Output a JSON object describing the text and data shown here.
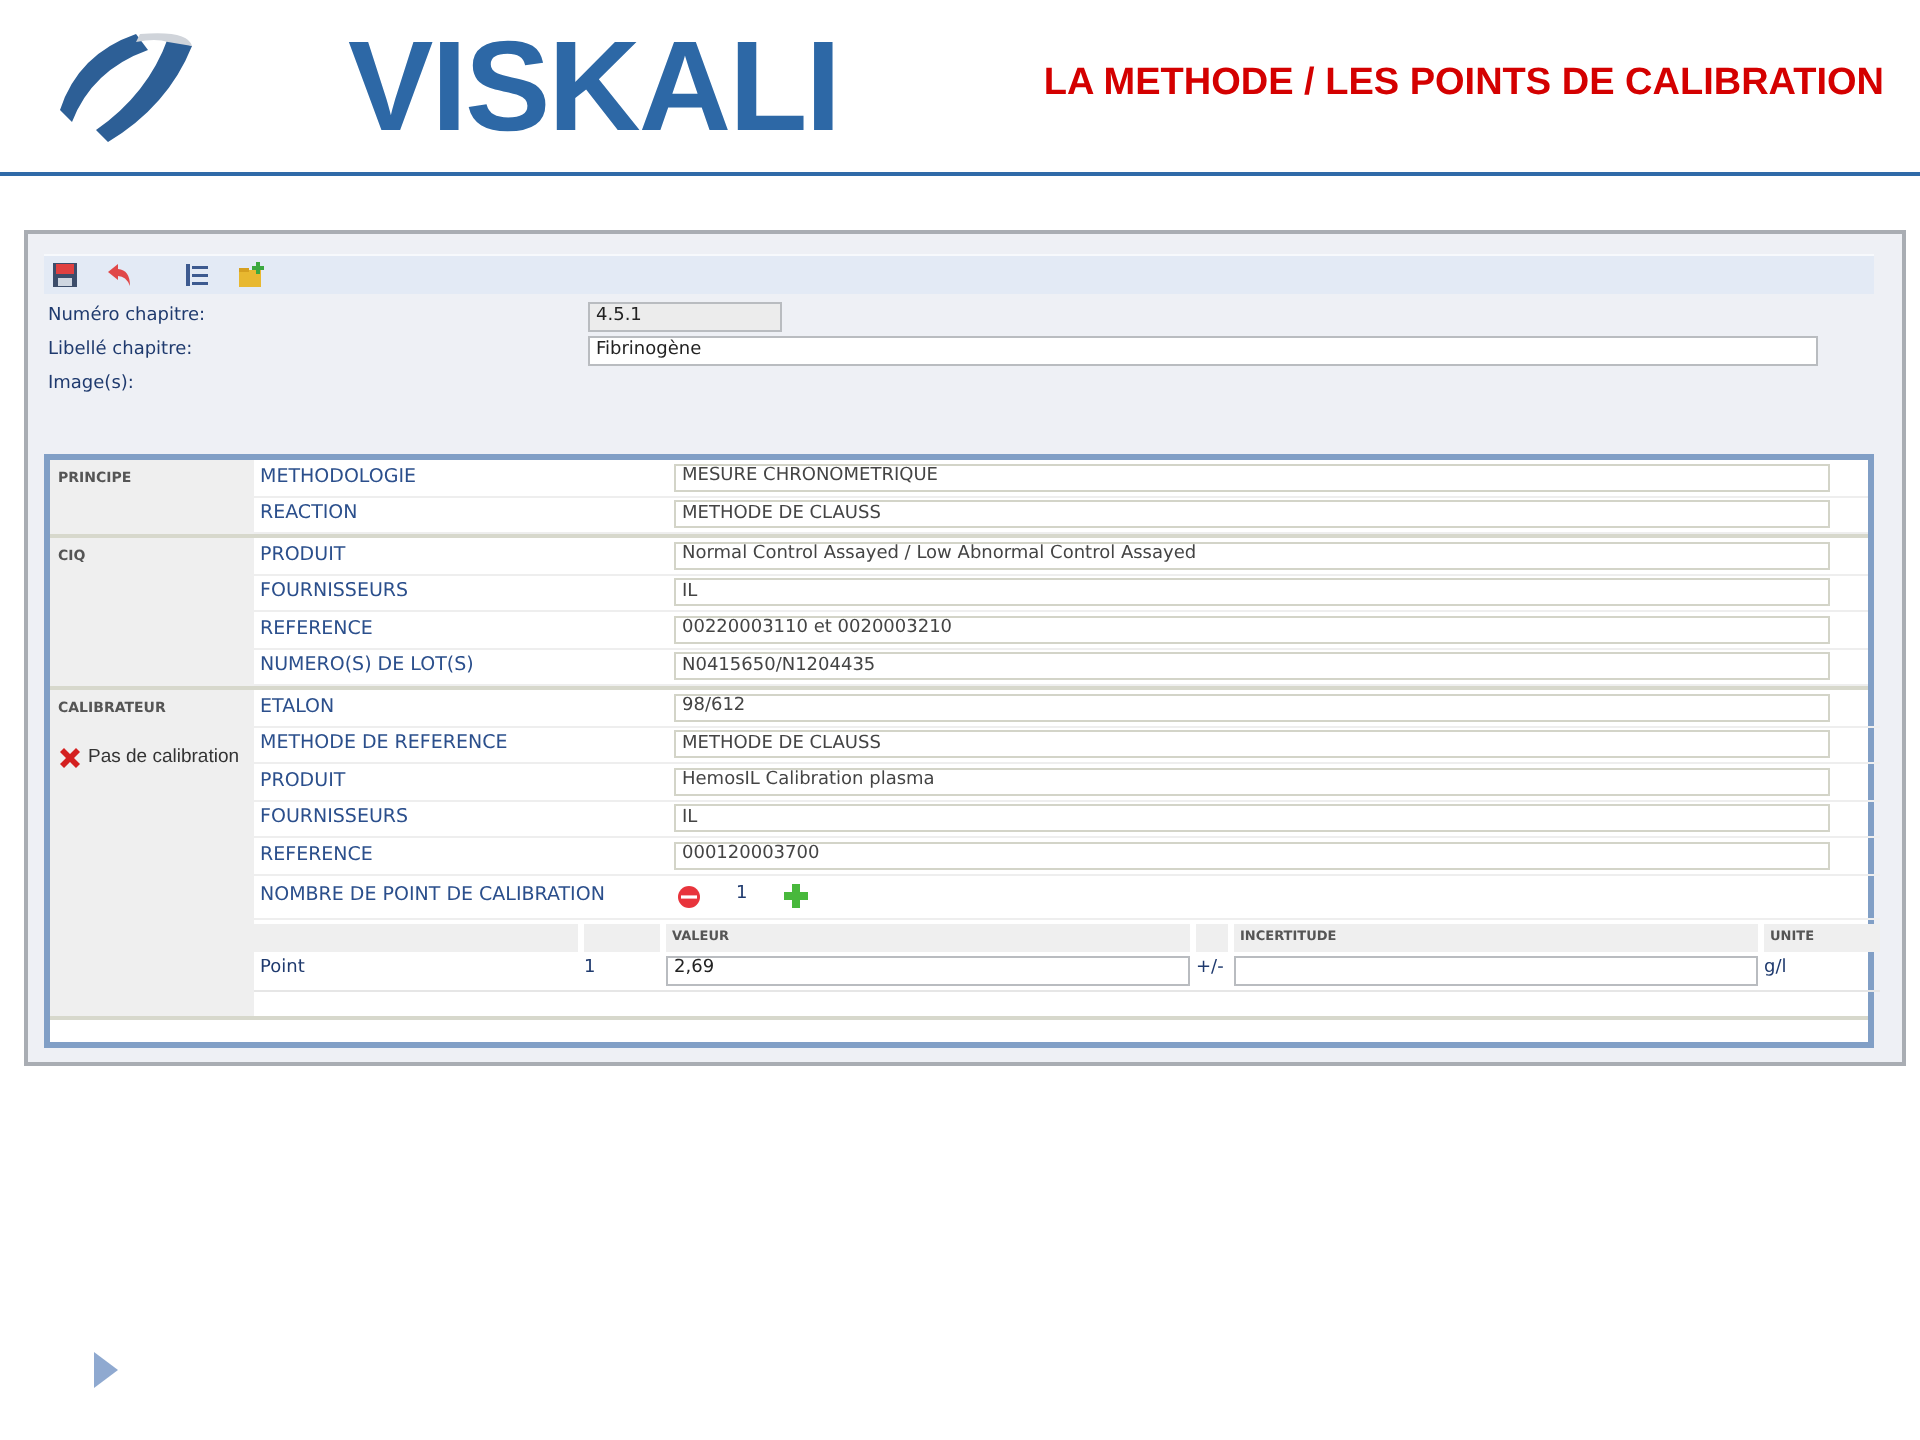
{
  "header": {
    "logo_text": "VISKALI",
    "title": "LA METHODE / LES POINTS DE CALIBRATION"
  },
  "chapter_fields": [
    {
      "label": "Numéro chapitre:",
      "value": "4.5.1",
      "disabled": true,
      "wide": false
    },
    {
      "label": "Libellé chapitre:",
      "value": "Fibrinogène",
      "disabled": false,
      "wide": true
    },
    {
      "label": "Image(s):"
    }
  ],
  "sections": [
    {
      "title": "PRINCIPE",
      "rows": [
        {
          "label": "METHODOLOGIE",
          "value": "MESURE CHRONOMETRIQUE"
        },
        {
          "label": "REACTION",
          "value": "METHODE DE CLAUSS"
        }
      ]
    },
    {
      "title": "CIQ",
      "rows": [
        {
          "label": "PRODUIT",
          "value": "Normal Control Assayed / Low Abnormal Control Assayed"
        },
        {
          "label": "FOURNISSEURS",
          "value": "IL"
        },
        {
          "label": "REFERENCE",
          "value": "00220003110 et 0020003210"
        },
        {
          "label": "NUMERO(S) DE LOT(S)",
          "value": "N0415650/N1204435"
        }
      ]
    },
    {
      "title": "CALIBRATEUR",
      "status": "Pas de calibration",
      "rows": [
        {
          "label": "ETALON",
          "value": "98/612"
        },
        {
          "label": "METHODE DE REFERENCE",
          "value": "METHODE DE CLAUSS"
        },
        {
          "label": "PRODUIT",
          "value": "HemosIL Calibration plasma"
        },
        {
          "label": "FOURNISSEURS",
          "value": "IL"
        },
        {
          "label": "REFERENCE",
          "value": "000120003700"
        }
      ],
      "count": {
        "label": "NOMBRE DE POINT DE CALIBRATION",
        "value": "1"
      },
      "points_table": {
        "columns": [
          "VALEUR",
          "INCERTITUDE",
          "UNITE"
        ],
        "rows": [
          {
            "label": "Point",
            "number": "1",
            "value": "2,69",
            "plusminus": "+/-",
            "unit": "g/l"
          }
        ]
      }
    }
  ]
}
